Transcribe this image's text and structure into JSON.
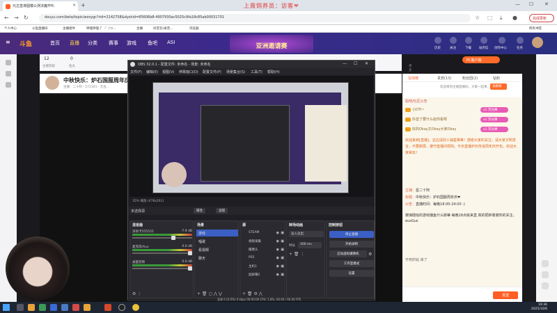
{
  "browser": {
    "tab_title": "元古皇淋圆模公测法魔开叭",
    "new_tab": "+",
    "decoration_text": "上周饲养员：访客❤",
    "url": "douyu.com/beta/topic/wzxygc?rid=2142758&dyshid=85606b8-4907930ac5025c9fa18c85ab00031701",
    "update_label": "完成更新",
    "bookmarks": [
      "个人中心",
      "斗鱼直播间",
      "主播组件",
      "呼哩呼哩 (゜-゜)つ...",
      "主播",
      "抖音云(录音...",
      "浏览器"
    ],
    "all_bookmarks": "所有书签"
  },
  "site": {
    "logo": "斗鱼",
    "nav": [
      "首页",
      "直播",
      "分类",
      "赛事",
      "游戏",
      "鱼吧",
      "ASI"
    ],
    "banner": "亚洲邀请赛",
    "top_icons": [
      "历史",
      "关注",
      "下载",
      "站内信",
      "创作中心",
      "任务"
    ]
  },
  "room_strip": {
    "items": [
      {
        "value": "12",
        "label": "主播等级"
      },
      {
        "value": "0",
        "label": "鱼丸"
      },
      {
        "value": "",
        "label": "更多"
      }
    ],
    "pc_badge": "PC客户端"
  },
  "room": {
    "title": "中秋快乐：炉石国服周年庆!",
    "meta": "主播：二十阿 · 572341 · 元古..."
  },
  "obs": {
    "title": "OBS 32.0.1 - 配置文件: 未命名 - 场景: 未命名",
    "menu": [
      "文件(F)",
      "编辑(E)",
      "视图(V)",
      "停靠窗口(D)",
      "配置文件(P)",
      "场景集合(S)",
      "工具(T)",
      "帮助(H)"
    ],
    "zoom": "35%",
    "canvas_size": "缩放 (478x261)",
    "no_source": "未选择源",
    "props_btn": "属性",
    "filters_btn": "滤镜",
    "mixer": {
      "title": "混音器",
      "tracks": [
        {
          "name": "深圳卡555555",
          "db": "-7.9 dB"
        },
        {
          "name": "麦克风/Aux",
          "db": "0.0 dB"
        },
        {
          "name": "桌面音频",
          "db": "0.0 dB"
        }
      ]
    },
    "scenes": {
      "title": "场景",
      "items": [
        "游戏",
        "唱歌",
        "看视频",
        "聊天"
      ]
    },
    "sources": {
      "title": "源",
      "items": [
        "STEAM",
        "视频采集",
        "摄像头",
        "PS5",
        "主机1",
        "副屏幕2"
      ]
    },
    "transitions": {
      "title": "转场动画",
      "selected": "淡入淡出",
      "duration_label": "时长",
      "duration_value": "300 ms"
    },
    "controls": {
      "title": "控制按钮",
      "buttons": [
        "停止直播",
        "开始录制",
        "启动虚拟摄像机",
        "工作室模式",
        "设置"
      ]
    },
    "statusbar": "丢帧 0 (0.0%)   0 kbps   00:00:00   CPU: 1.8%, 60.00 / 60.00 FPS"
  },
  "chat_panel": {
    "tabs": [
      "在线榜",
      "贵宾(13)",
      "粉丝团(2)",
      "钻粉"
    ],
    "subtitle": "欢迎来到主播直播间，大家一起来...",
    "rank_btn": "贡献榜",
    "notice_title": "贴吧/社区公告",
    "lines": [
      {
        "user": "小DTI",
        "text": "~"
      },
      {
        "user": "抖音了要什么给你看呀",
        "text": ""
      },
      {
        "user": "好的Okay又Okay大家Okay",
        "text": ""
      }
    ],
    "gifts": [
      "x1 荧光棒",
      "x1 荧光棒",
      "x1 荧光棒"
    ],
    "announcement": "欢迎来到[直播]，这边请别人抽盒等等！感谢大家的关注，请大家文明发言，不要刷屏，遵守直播间规则。今天直播炉石传说周年庆开包，欢迎大家来玩！",
    "info": [
      {
        "label": "主播：",
        "value": "星二十阿"
      },
      {
        "label": "标题：",
        "value": "中秋快乐：炉石国服周年庆❤"
      },
      {
        "label": "公告：",
        "value": "直播时间：每晚18:00-24:00 :)"
      }
    ],
    "bulletin": "玻璃碴哒的游戏播鱼什么斯蒂 每晚18点就来直 真的把醉谢谢你的关注，eusGus",
    "footer_line": "不死的钻 来了",
    "send": "发送"
  },
  "taskbar": {
    "time": "19:36",
    "date": "2025/10/6"
  }
}
